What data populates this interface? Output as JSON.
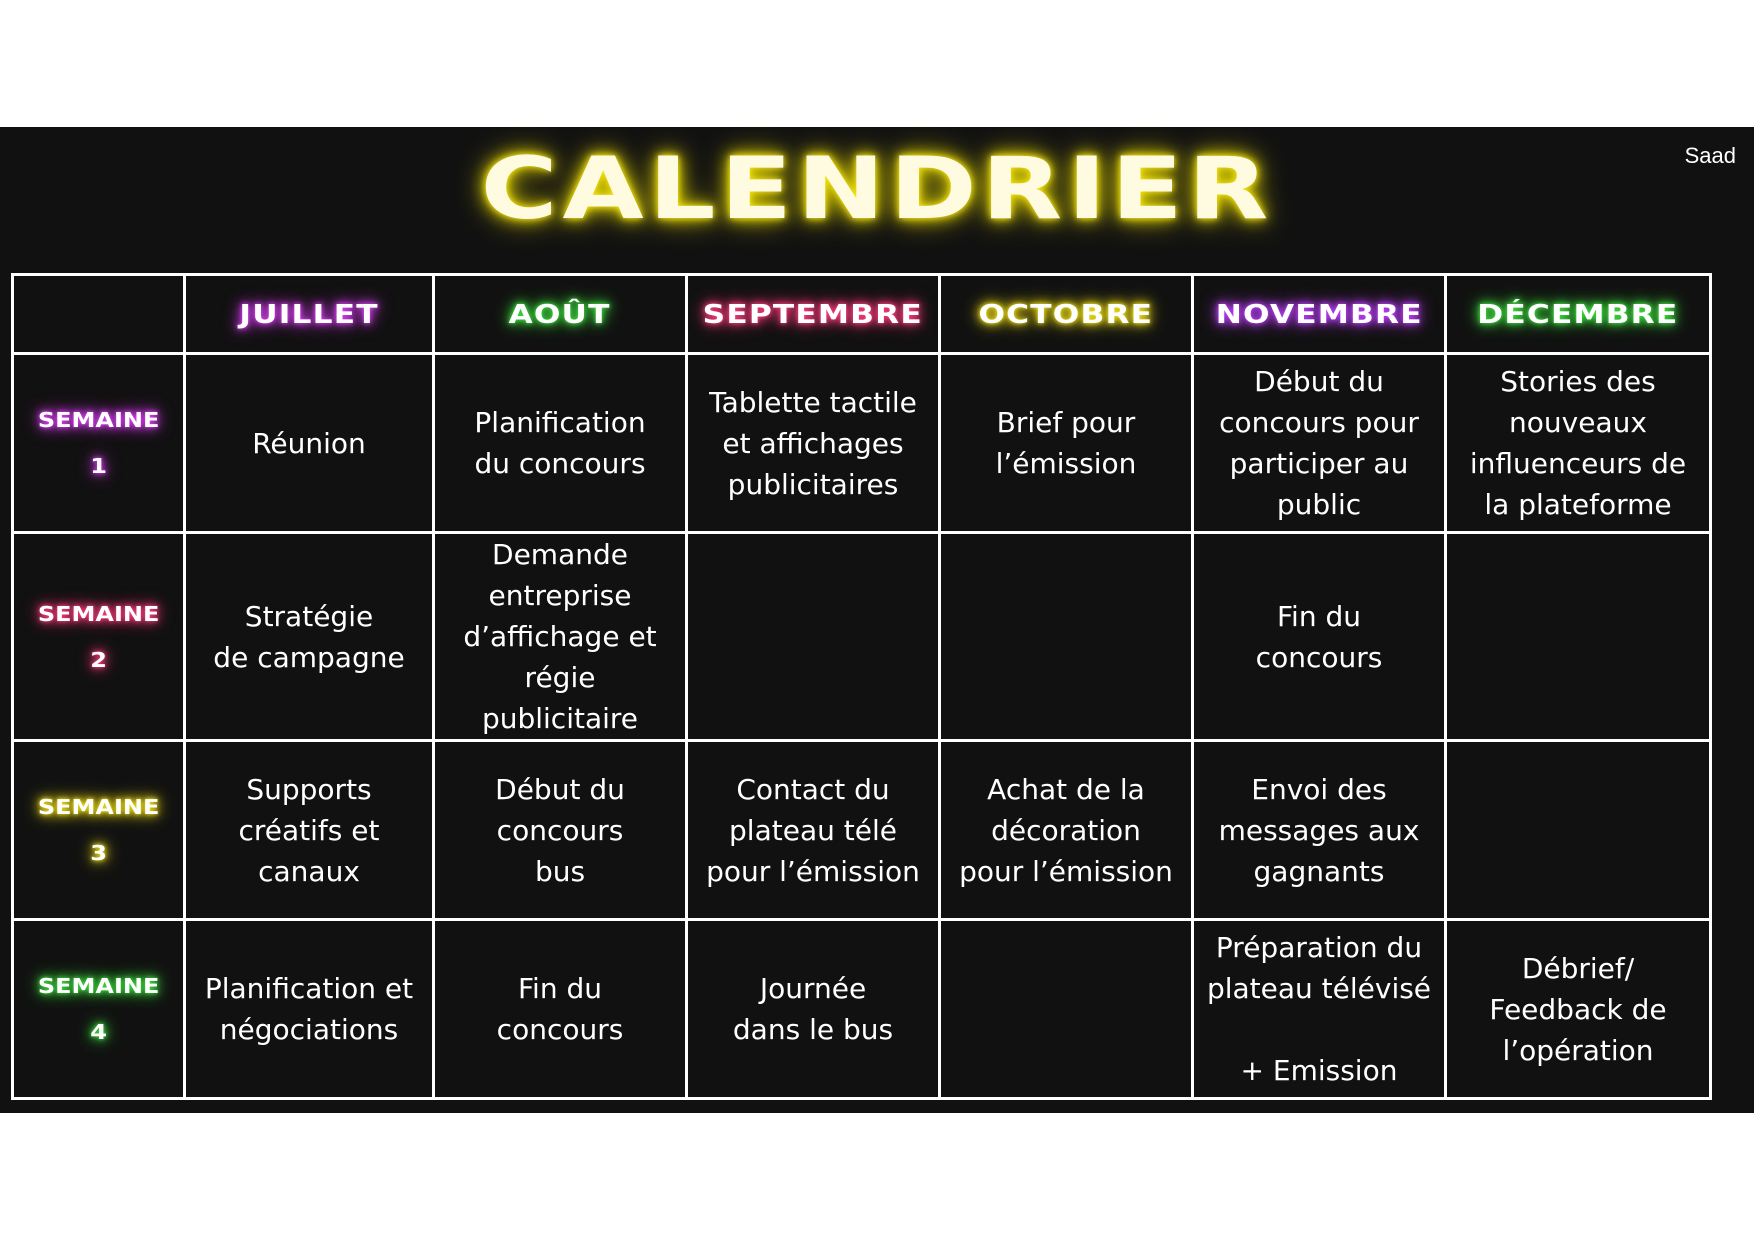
{
  "author": "Saad",
  "title": "CALENDRIER",
  "title_glow_color": "#f8e71c",
  "months": [
    {
      "label": "JUILLET",
      "glow": "#e040fb"
    },
    {
      "label": "AOÛT",
      "glow": "#40e040"
    },
    {
      "label": "SEPTEMBRE",
      "glow": "#ff3d7f"
    },
    {
      "label": "OCTOBRE",
      "glow": "#f8e71c"
    },
    {
      "label": "NOVEMBRE",
      "glow": "#c040ff"
    },
    {
      "label": "DÉCEMBRE",
      "glow": "#40e040"
    }
  ],
  "weeks": [
    {
      "label": "SEMAINE\n1",
      "glow": "#e040fb",
      "cells": [
        "Réunion",
        "Planification\ndu concours",
        "Tablette tactile\net affichages\npublicitaires",
        "Brief pour\nl’émission",
        "Début du\nconcours pour\nparticiper au\npublic",
        "Stories des\nnouveaux\ninfluenceurs de\nla plateforme"
      ]
    },
    {
      "label": "SEMAINE\n2",
      "glow": "#ff3d7f",
      "cells": [
        "Stratégie\nde campagne",
        "Demande\nentreprise\nd’affichage et régie\npublicitaire",
        "",
        "",
        "Fin du\nconcours",
        ""
      ]
    },
    {
      "label": "SEMAINE\n3",
      "glow": "#f8e71c",
      "cells": [
        "Supports\ncréatifs et\ncanaux",
        "Début du\nconcours\nbus",
        "Contact du\nplateau télé\npour l’émission",
        "Achat de la\ndécoration\npour l’émission",
        "Envoi des\nmessages aux\ngagnants",
        ""
      ]
    },
    {
      "label": "SEMAINE\n4",
      "glow": "#40e040",
      "cells": [
        "Planification et\nnégociations",
        "Fin du\nconcours",
        "Journée\ndans le bus",
        "",
        "Préparation du\nplateau télévisé\n\n+ Emission",
        "Débrief/\nFeedback de\nl’opération"
      ]
    }
  ]
}
